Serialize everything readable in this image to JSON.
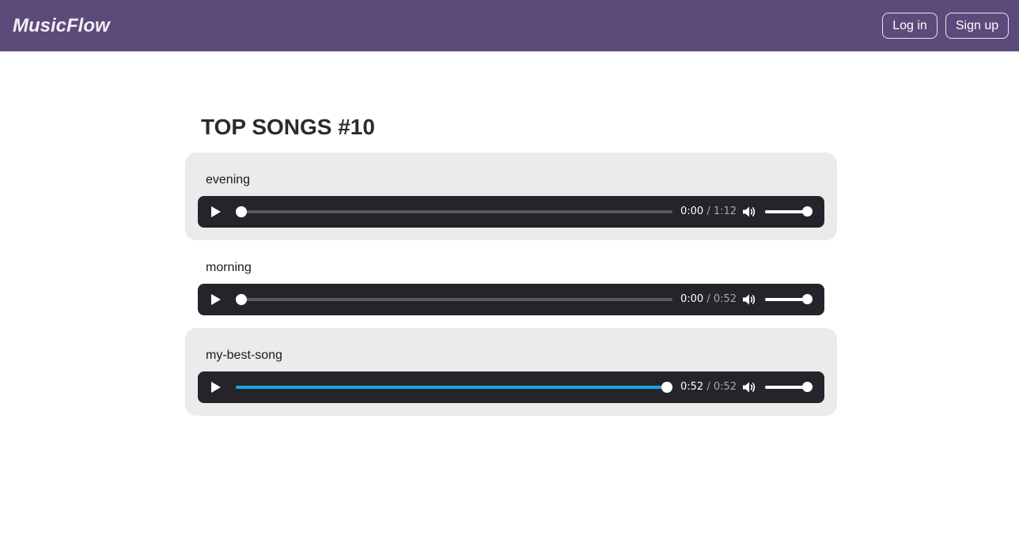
{
  "header": {
    "brand": "MusicFlow",
    "login_label": "Log in",
    "signup_label": "Sign up",
    "background_color": "#5c4a7a"
  },
  "main": {
    "title": "TOP SONGS #10",
    "songs": [
      {
        "name": "evening",
        "current_time": "0:00",
        "duration": "1:12",
        "progress": 0,
        "volume": 1,
        "highlighted": true
      },
      {
        "name": "morning",
        "current_time": "0:00",
        "duration": "0:52",
        "progress": 0,
        "volume": 1,
        "highlighted": false
      },
      {
        "name": "my-best-song",
        "current_time": "0:52",
        "duration": "0:52",
        "progress": 1,
        "volume": 1,
        "highlighted": true
      }
    ]
  },
  "icons": {
    "play": "play-icon",
    "volume": "volume-icon"
  },
  "colors": {
    "player_background": "#26232b",
    "progress_fill": "#1aa5e6",
    "card_background": "#ebebeb"
  }
}
